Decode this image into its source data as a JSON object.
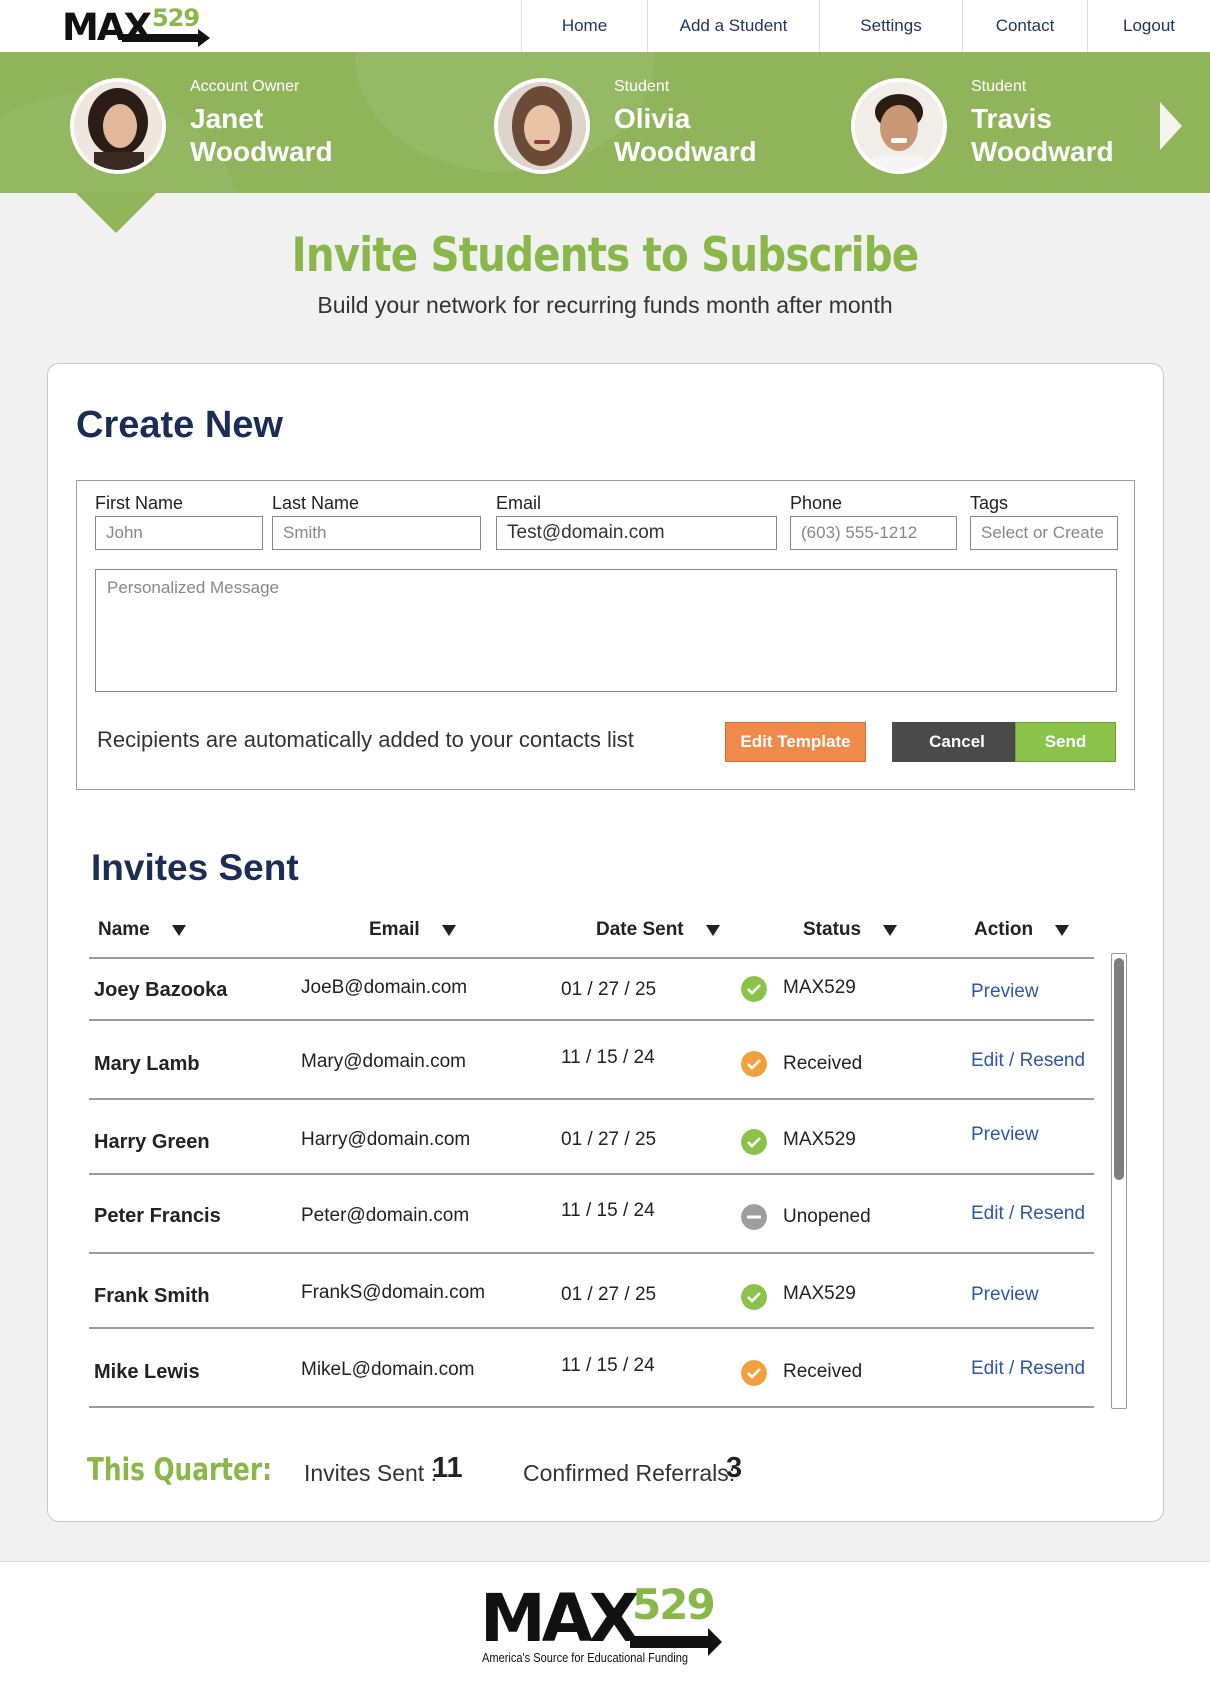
{
  "brand": {
    "logo_max": "MAX",
    "logo_num": "529",
    "tagline": "America's Source for Educational Funding"
  },
  "nav": {
    "home": "Home",
    "add_student": "Add a Student",
    "settings": "Settings",
    "contact": "Contact",
    "logout": "Logout"
  },
  "people": [
    {
      "role": "Account Owner",
      "first": "Janet",
      "last": "Woodward"
    },
    {
      "role": "Student",
      "first": "Olivia",
      "last": "Woodward"
    },
    {
      "role": "Student",
      "first": "Travis",
      "last": "Woodward"
    }
  ],
  "page": {
    "title": "Invite Students to Subscribe",
    "subtitle": "Build your network for recurring funds month after month"
  },
  "create": {
    "heading": "Create New",
    "fields": {
      "first_name": {
        "label": "First Name",
        "placeholder": "John"
      },
      "last_name": {
        "label": "Last Name",
        "placeholder": "Smith"
      },
      "email": {
        "label": "Email",
        "value": "Test@domain.com"
      },
      "phone": {
        "label": "Phone",
        "placeholder": "(603) 555-1212"
      },
      "tags": {
        "label": "Tags",
        "placeholder": "Select or Create"
      }
    },
    "message_placeholder": "Personalized Message",
    "note": "Recipients are automatically added to your contacts list",
    "buttons": {
      "edit_template": "Edit Template",
      "cancel": "Cancel",
      "send": "Send"
    }
  },
  "invites": {
    "heading": "Invites Sent",
    "columns": [
      "Name",
      "Email",
      "Date Sent",
      "Status",
      "Action"
    ],
    "rows": [
      {
        "name": "Joey Bazooka",
        "email": "JoeB@domain.com",
        "date": "01 / 27 / 25",
        "status": "MAX529",
        "status_kind": "check",
        "action": "Preview"
      },
      {
        "name": "Mary Lamb",
        "email": "Mary@domain.com",
        "date": "11 / 15 / 24",
        "status": "Received",
        "status_kind": "received",
        "action": "Edit / Resend"
      },
      {
        "name": "Harry Green",
        "email": "Harry@domain.com",
        "date": "01 / 27 / 25",
        "status": "MAX529",
        "status_kind": "check",
        "action": "Preview"
      },
      {
        "name": "Peter Francis",
        "email": "Peter@domain.com",
        "date": "11 / 15 / 24",
        "status": "Unopened",
        "status_kind": "unopened",
        "action": "Edit / Resend"
      },
      {
        "name": "Frank Smith",
        "email": "FrankS@domain.com",
        "date": "01 / 27 / 25",
        "status": "MAX529",
        "status_kind": "check",
        "action": "Preview"
      },
      {
        "name": "Mike Lewis",
        "email": "MikeL@domain.com",
        "date": "11 / 15 / 24",
        "status": "Received",
        "status_kind": "received",
        "action": "Edit / Resend"
      }
    ]
  },
  "quarter": {
    "label": "This Quarter:",
    "invites_label": "Invites Sent :",
    "invites_value": "11",
    "referrals_label": "Confirmed Referrals:",
    "referrals_value": "3"
  },
  "colors": {
    "brand_green": "#8fb45a",
    "navy": "#1c2d55",
    "orange": "#f08a4b",
    "dark_button": "#4a4a4a",
    "send_green": "#8bc34a",
    "link_blue": "#2e57a8",
    "check": "#8bc34a",
    "received": "#f0a03c",
    "unopened": "#9e9e9e"
  }
}
